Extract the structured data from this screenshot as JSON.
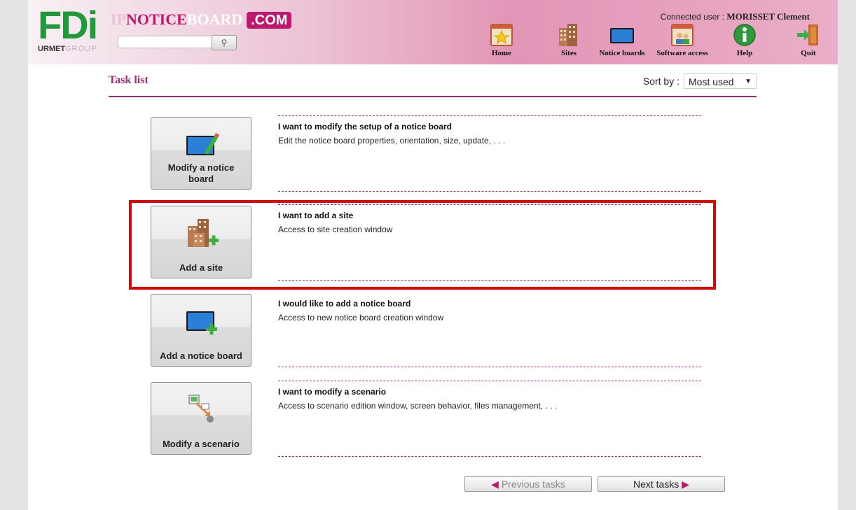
{
  "header": {
    "logo_main": "FDi",
    "logo_sub_1": "URMET",
    "logo_sub_2": "GROUP",
    "brand_ip": "IP",
    "brand_notice": "NOTICE",
    "brand_board": "BOARD",
    "brand_com": ".COM",
    "search_value": "",
    "connected_label": "Connected user :",
    "connected_user": "MORISSET Clement",
    "nav": [
      {
        "label": "Home",
        "icon": "home-icon"
      },
      {
        "label": "Sites",
        "icon": "sites-icon"
      },
      {
        "label": "Notice boards",
        "icon": "notice-boards-icon"
      },
      {
        "label": "Software access",
        "icon": "software-access-icon"
      },
      {
        "label": "Help",
        "icon": "help-icon"
      },
      {
        "label": "Quit",
        "icon": "quit-icon"
      }
    ]
  },
  "tasklist": {
    "title": "Task list",
    "sort_label": "Sort by :",
    "sort_value": "Most used",
    "tasks": [
      {
        "tile": "Modify a notice board",
        "title": "I want to modify the setup of a notice board",
        "text": "Edit the notice board properties, orientation, size, update, . . ."
      },
      {
        "tile": "Add a site",
        "title": "I want to add a site",
        "text": "Access to site creation window"
      },
      {
        "tile": "Add a notice board",
        "title": "I would like to add a notice board",
        "text": "Access to new notice board creation window"
      },
      {
        "tile": "Modify a scenario",
        "title": "I want to modify a scenario",
        "text": "Access to scenario edition window, screen behavior, files management, . . ."
      }
    ],
    "prev_label": "Previous tasks",
    "next_label": "Next tasks"
  },
  "colors": {
    "accent": "#a12c76",
    "brand_pink": "#c0166e",
    "logo_green": "#1f9a3b",
    "highlight": "#e00000"
  }
}
